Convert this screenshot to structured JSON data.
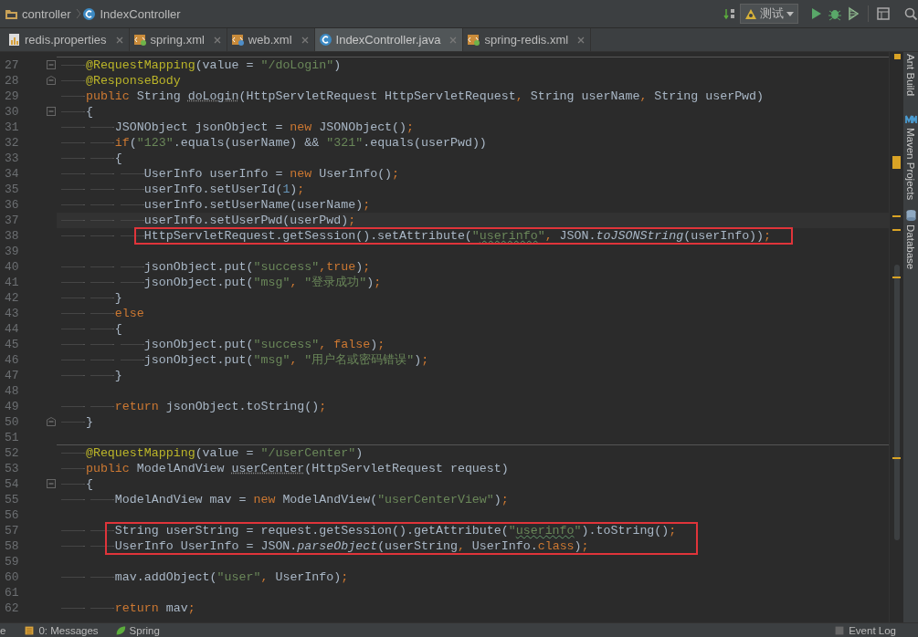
{
  "breadcrumbs": [
    {
      "label": "controller",
      "kind": "folder"
    },
    {
      "label": "IndexController",
      "kind": "class"
    }
  ],
  "run_config": {
    "label": "测试"
  },
  "tabs": [
    {
      "label": "redis.properties",
      "kind": "properties",
      "selected": false
    },
    {
      "label": "spring.xml",
      "kind": "xml",
      "selected": false
    },
    {
      "label": "web.xml",
      "kind": "web",
      "selected": false
    },
    {
      "label": "IndexController.java",
      "kind": "class",
      "selected": true
    },
    {
      "label": "spring-redis.xml",
      "kind": "xml",
      "selected": false
    }
  ],
  "editor": {
    "lines": [
      {
        "number": "27",
        "separator_above": true,
        "fold_start": true,
        "tokens": [
          {
            "text": "\t@RequestMapping",
            "kind": "annotation"
          },
          {
            "text": "(value = ",
            "kind": "plain"
          },
          {
            "text": "\"/doLogin\"",
            "kind": "string"
          },
          {
            "text": ")",
            "kind": "plain"
          }
        ]
      },
      {
        "number": "28",
        "fold_end": true,
        "tokens": [
          {
            "text": "\t@ResponseBody",
            "kind": "annotation"
          }
        ]
      },
      {
        "number": "29",
        "tokens": [
          {
            "text": "\tpublic",
            "kind": "keyword"
          },
          {
            "text": " String ",
            "kind": "plain"
          },
          {
            "text": "doLogin",
            "kind": "declaration"
          },
          {
            "text": "(HttpServletRequest HttpServletRequest",
            "kind": "plain"
          },
          {
            "text": ",",
            "kind": "keyword"
          },
          {
            "text": " String userName",
            "kind": "plain"
          },
          {
            "text": ",",
            "kind": "keyword"
          },
          {
            "text": " String userPwd)",
            "kind": "plain"
          }
        ]
      },
      {
        "number": "30",
        "fold_start": true,
        "tokens": [
          {
            "text": "\t{",
            "kind": "plain"
          }
        ]
      },
      {
        "number": "31",
        "tokens": [
          {
            "text": "\t\tJSONObject jsonObject = ",
            "kind": "plain"
          },
          {
            "text": "new",
            "kind": "keyword"
          },
          {
            "text": " JSONObject()",
            "kind": "plain"
          },
          {
            "text": ";",
            "kind": "keyword"
          }
        ]
      },
      {
        "number": "32",
        "tokens": [
          {
            "text": "\t\tif",
            "kind": "keyword"
          },
          {
            "text": "(",
            "kind": "plain"
          },
          {
            "text": "\"123\"",
            "kind": "string"
          },
          {
            "text": ".equals(userName) && ",
            "kind": "plain"
          },
          {
            "text": "\"321\"",
            "kind": "string"
          },
          {
            "text": ".equals(userPwd))",
            "kind": "plain"
          }
        ]
      },
      {
        "number": "33",
        "tokens": [
          {
            "text": "\t\t{",
            "kind": "plain"
          }
        ]
      },
      {
        "number": "34",
        "tokens": [
          {
            "text": "\t\t\tUserInfo userInfo = ",
            "kind": "plain"
          },
          {
            "text": "new",
            "kind": "keyword"
          },
          {
            "text": " UserInfo()",
            "kind": "plain"
          },
          {
            "text": ";",
            "kind": "keyword"
          }
        ]
      },
      {
        "number": "35",
        "tokens": [
          {
            "text": "\t\t\tuserInfo.setUserId(",
            "kind": "plain"
          },
          {
            "text": "1",
            "kind": "number"
          },
          {
            "text": ")",
            "kind": "plain"
          },
          {
            "text": ";",
            "kind": "keyword"
          }
        ]
      },
      {
        "number": "36",
        "tokens": [
          {
            "text": "\t\t\tuserInfo.setUserName(userName)",
            "kind": "plain"
          },
          {
            "text": ";",
            "kind": "keyword"
          }
        ]
      },
      {
        "number": "37",
        "current": true,
        "tokens": [
          {
            "text": "\t\t\tuserInfo.setUserPwd(userPwd)",
            "kind": "plain"
          },
          {
            "text": ";",
            "kind": "keyword"
          }
        ]
      },
      {
        "number": "38",
        "boxed": true,
        "tokens": [
          {
            "text": "\t\t\tHttpServletRequest.getSession().setAttribute(",
            "kind": "plain"
          },
          {
            "text": "\"",
            "kind": "string"
          },
          {
            "text": "userinfo",
            "kind": "typo"
          },
          {
            "text": "\"",
            "kind": "string"
          },
          {
            "text": ",",
            "kind": "keyword"
          },
          {
            "text": " JSON.",
            "kind": "plain"
          },
          {
            "text": "toJSONString",
            "kind": "italic"
          },
          {
            "text": "(userInfo))",
            "kind": "plain"
          },
          {
            "text": ";",
            "kind": "keyword"
          }
        ]
      },
      {
        "number": "39"
      },
      {
        "number": "40",
        "tokens": [
          {
            "text": "\t\t\tjsonObject.put(",
            "kind": "plain"
          },
          {
            "text": "\"success\"",
            "kind": "string"
          },
          {
            "text": ",true",
            "kind": "keyword"
          },
          {
            "text": ")",
            "kind": "plain"
          },
          {
            "text": ";",
            "kind": "keyword"
          }
        ]
      },
      {
        "number": "41",
        "tokens": [
          {
            "text": "\t\t\tjsonObject.put(",
            "kind": "plain"
          },
          {
            "text": "\"msg\"",
            "kind": "string"
          },
          {
            "text": ",",
            "kind": "keyword"
          },
          {
            "text": " \"登录成功\"",
            "kind": "string"
          },
          {
            "text": ")",
            "kind": "plain"
          },
          {
            "text": ";",
            "kind": "keyword"
          }
        ]
      },
      {
        "number": "42",
        "tokens": [
          {
            "text": "\t\t}",
            "kind": "plain"
          }
        ]
      },
      {
        "number": "43",
        "tokens": [
          {
            "text": "\t\telse",
            "kind": "keyword"
          }
        ]
      },
      {
        "number": "44",
        "tokens": [
          {
            "text": "\t\t{",
            "kind": "plain"
          }
        ]
      },
      {
        "number": "45",
        "tokens": [
          {
            "text": "\t\t\tjsonObject.put(",
            "kind": "plain"
          },
          {
            "text": "\"success\"",
            "kind": "string"
          },
          {
            "text": ", false",
            "kind": "keyword"
          },
          {
            "text": ")",
            "kind": "plain"
          },
          {
            "text": ";",
            "kind": "keyword"
          }
        ]
      },
      {
        "number": "46",
        "tokens": [
          {
            "text": "\t\t\tjsonObject.put(",
            "kind": "plain"
          },
          {
            "text": "\"msg\"",
            "kind": "string"
          },
          {
            "text": ",",
            "kind": "keyword"
          },
          {
            "text": " \"用户名或密码错误\"",
            "kind": "string"
          },
          {
            "text": ")",
            "kind": "plain"
          },
          {
            "text": ";",
            "kind": "keyword"
          }
        ]
      },
      {
        "number": "47",
        "tokens": [
          {
            "text": "\t\t}",
            "kind": "plain"
          }
        ]
      },
      {
        "number": "48"
      },
      {
        "number": "49",
        "tokens": [
          {
            "text": "\t\treturn",
            "kind": "keyword"
          },
          {
            "text": " jsonObject.toString()",
            "kind": "plain"
          },
          {
            "text": ";",
            "kind": "keyword"
          }
        ]
      },
      {
        "number": "50",
        "fold_end": true,
        "tokens": [
          {
            "text": "\t}",
            "kind": "plain"
          }
        ]
      },
      {
        "number": "51"
      },
      {
        "number": "52",
        "separator_above": true,
        "tokens": [
          {
            "text": "\t@RequestMapping",
            "kind": "annotation"
          },
          {
            "text": "(value = ",
            "kind": "plain"
          },
          {
            "text": "\"/userCenter\"",
            "kind": "string"
          },
          {
            "text": ")",
            "kind": "plain"
          }
        ]
      },
      {
        "number": "53",
        "tokens": [
          {
            "text": "\tpublic",
            "kind": "keyword"
          },
          {
            "text": " ModelAndView ",
            "kind": "plain"
          },
          {
            "text": "userCenter",
            "kind": "declaration"
          },
          {
            "text": "(HttpServletRequest request)",
            "kind": "plain"
          }
        ]
      },
      {
        "number": "54",
        "fold_start": true,
        "tokens": [
          {
            "text": "\t{",
            "kind": "plain"
          }
        ]
      },
      {
        "number": "55",
        "tokens": [
          {
            "text": "\t\tModelAndView mav = ",
            "kind": "plain"
          },
          {
            "text": "new",
            "kind": "keyword"
          },
          {
            "text": " ModelAndView(",
            "kind": "plain"
          },
          {
            "text": "\"userCenterView\"",
            "kind": "string"
          },
          {
            "text": ")",
            "kind": "plain"
          },
          {
            "text": ";",
            "kind": "keyword"
          }
        ]
      },
      {
        "number": "56"
      },
      {
        "number": "57",
        "boxed": true,
        "tokens": [
          {
            "text": "\t\tString userString = request.getSession().getAttribute(",
            "kind": "plain"
          },
          {
            "text": "\"",
            "kind": "string"
          },
          {
            "text": "userinfo",
            "kind": "typo"
          },
          {
            "text": "\"",
            "kind": "string"
          },
          {
            "text": ").toString()",
            "kind": "plain"
          },
          {
            "text": ";",
            "kind": "keyword"
          }
        ]
      },
      {
        "number": "58",
        "boxed": true,
        "tokens": [
          {
            "text": "\t\tUserInfo UserInfo = JSON.",
            "kind": "plain"
          },
          {
            "text": "parseObject",
            "kind": "italic"
          },
          {
            "text": "(userString",
            "kind": "plain"
          },
          {
            "text": ",",
            "kind": "keyword"
          },
          {
            "text": " UserInfo.",
            "kind": "plain"
          },
          {
            "text": "class",
            "kind": "keyword"
          },
          {
            "text": ")",
            "kind": "plain"
          },
          {
            "text": ";",
            "kind": "keyword"
          }
        ]
      },
      {
        "number": "59"
      },
      {
        "number": "60",
        "tokens": [
          {
            "text": "\t\tmav.addObject(",
            "kind": "plain"
          },
          {
            "text": "\"user\"",
            "kind": "string"
          },
          {
            "text": ",",
            "kind": "keyword"
          },
          {
            "text": " UserInfo)",
            "kind": "plain"
          },
          {
            "text": ";",
            "kind": "keyword"
          }
        ]
      },
      {
        "number": "61"
      },
      {
        "number": "62",
        "tokens": [
          {
            "text": "\t\treturn",
            "kind": "keyword"
          },
          {
            "text": " mav",
            "kind": "plain"
          },
          {
            "text": ";",
            "kind": "keyword"
          }
        ]
      }
    ]
  },
  "tool_windows": [
    {
      "label": "Ant Build",
      "kind": "ant"
    },
    {
      "label": "Maven Projects",
      "kind": "maven"
    },
    {
      "label": "Database",
      "kind": "database"
    }
  ],
  "status_bar": {
    "left": [
      {
        "label": "e",
        "kind": "none"
      },
      {
        "label": "0: Messages",
        "kind": "messages"
      },
      {
        "label": "Spring",
        "kind": "spring"
      }
    ],
    "right": [
      {
        "label": "Event Log",
        "kind": "log"
      }
    ]
  }
}
